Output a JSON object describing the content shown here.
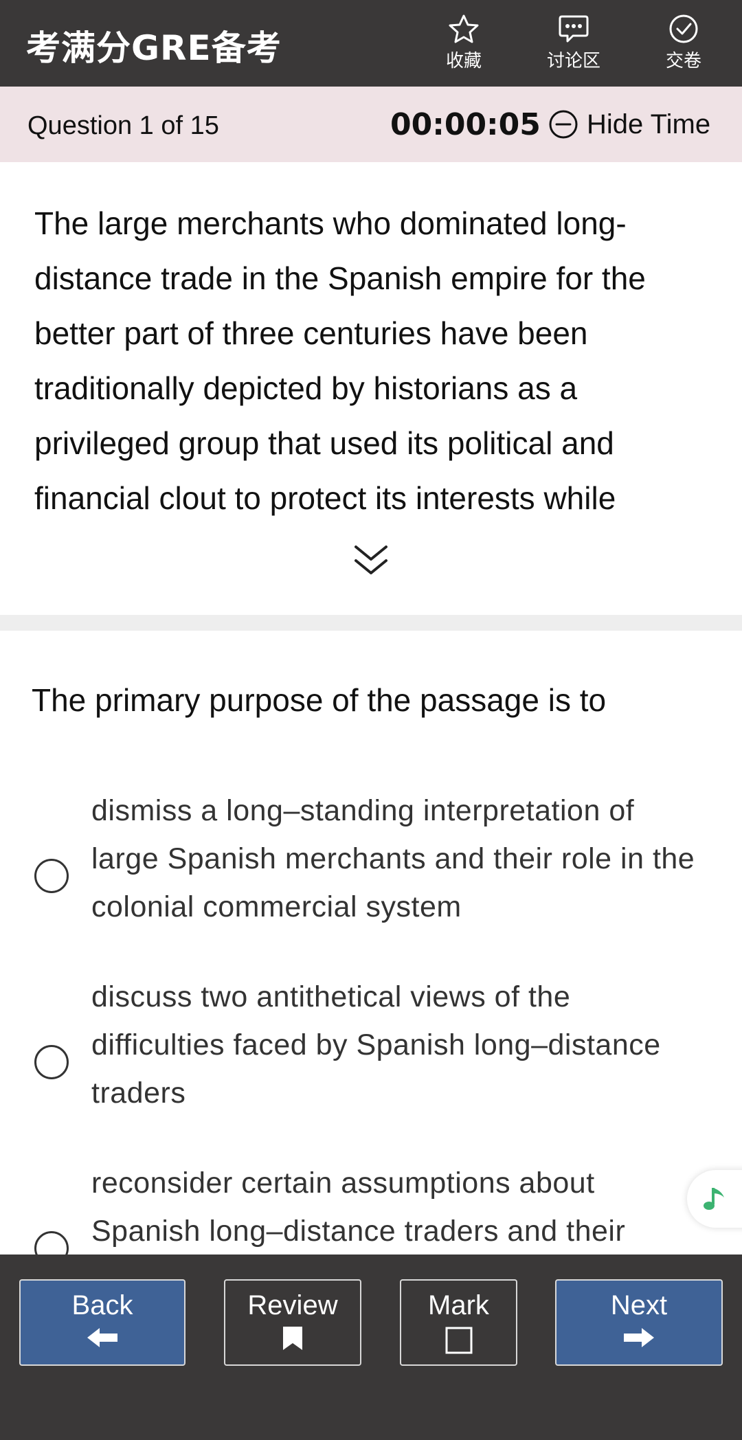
{
  "header": {
    "app_title": "考满分GRE备考",
    "favorite_label": "收藏",
    "discussion_label": "讨论区",
    "submit_label": "交卷"
  },
  "status_bar": {
    "question_counter": "Question 1 of 15",
    "timer": "00:00:05",
    "hide_time_label": "Hide Time"
  },
  "passage": {
    "text": "The large merchants who dominated long-distance trade in the Spanish empire for the better part of three centuries have been traditionally depicted by historians as a privileged group that used its political and financial clout to protect its interests while"
  },
  "question": {
    "prompt": "The primary purpose of the passage is to",
    "options": [
      {
        "text": "dismiss a long–standing interpretation of large Spanish merchants and their role in the colonial commercial system",
        "selected": false
      },
      {
        "text": "discuss two antithetical views of the difficulties faced by Spanish long–distance traders",
        "selected": false
      },
      {
        "text": "reconsider certain assumptions about Spanish long–distance traders and their",
        "selected": false
      }
    ]
  },
  "footer": {
    "back_label": "Back",
    "review_label": "Review",
    "mark_label": "Mark",
    "next_label": "Next"
  },
  "colors": {
    "header_bg": "#3a3838",
    "status_bar_bg": "#efe2e5",
    "primary_button": "#3f6296",
    "music_icon": "#3cb371"
  },
  "icons": {
    "favorite": "star-icon",
    "discussion": "chat-icon",
    "submit": "check-circle-icon",
    "hide_time": "minus-circle-icon",
    "expand": "double-chevron-down-icon",
    "music": "music-note-icon",
    "back": "arrow-left-icon",
    "review": "bookmark-icon",
    "mark": "checkbox-icon",
    "next": "arrow-right-icon"
  }
}
